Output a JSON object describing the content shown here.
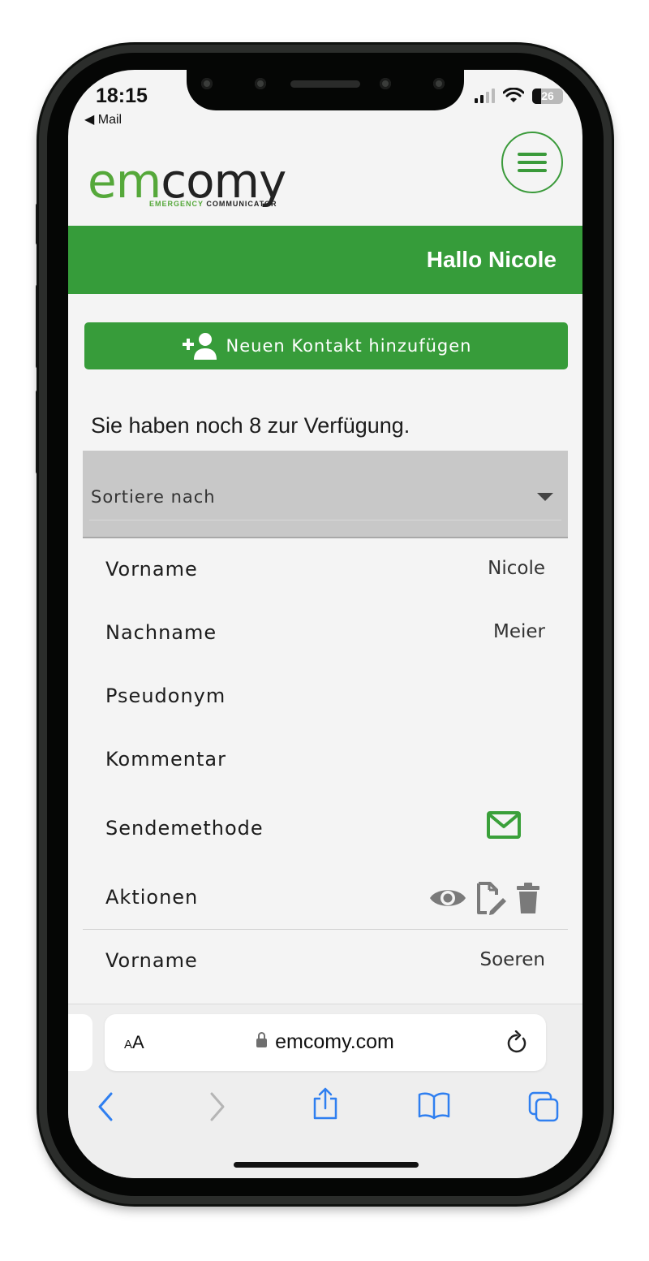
{
  "status_bar": {
    "time": "18:15",
    "back_app": "◀ Mail",
    "battery": "26"
  },
  "brand": {
    "name_part1": "e",
    "name_part2": "m",
    "name_part3": "comy",
    "tagline_part1": "EMERGENCY",
    "tagline_part2": "COMMUNICATOR",
    "accent_color": "#369c3a"
  },
  "header": {
    "greeting": "Hallo Nicole"
  },
  "main": {
    "add_contact_label": "Neuen Kontakt hinzufügen",
    "availability_text": "Sie haben noch 8 zur Verfügung.",
    "sort_placeholder": "Sortiere nach"
  },
  "contacts": [
    {
      "fields": [
        {
          "label": "Vorname",
          "value": "Nicole"
        },
        {
          "label": "Nachname",
          "value": "Meier"
        },
        {
          "label": "Pseudonym",
          "value": ""
        },
        {
          "label": "Kommentar",
          "value": ""
        },
        {
          "label": "Sendemethode",
          "value": "",
          "icon": "mail-icon"
        },
        {
          "label": "Aktionen",
          "value": "",
          "icons": [
            "eye-icon",
            "edit-document-icon",
            "trash-icon"
          ]
        }
      ]
    },
    {
      "fields": [
        {
          "label": "Vorname",
          "value": "Soeren"
        }
      ]
    }
  ],
  "browser": {
    "text_size_label": "AA",
    "url": "emcomy.com"
  }
}
